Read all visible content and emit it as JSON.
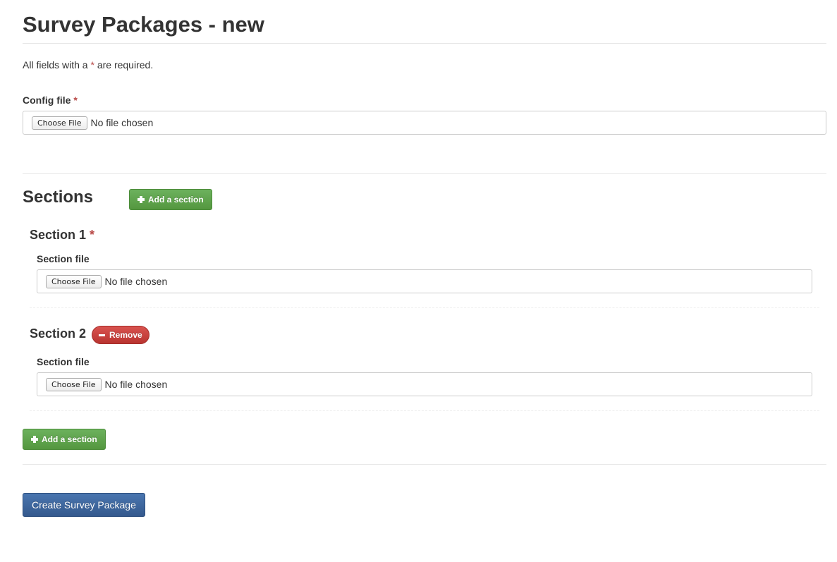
{
  "page": {
    "title": "Survey Packages - new",
    "required_note_prefix": "All fields with a ",
    "required_marker": "*",
    "required_note_suffix": " are required."
  },
  "config": {
    "label": "Config file",
    "choose_label": "Choose File",
    "status": "No file chosen"
  },
  "sections": {
    "heading": "Sections",
    "add_label": "Add a section",
    "items": [
      {
        "title": "Section 1",
        "file_label": "Section file",
        "choose_label": "Choose File",
        "status": "No file chosen"
      },
      {
        "title": "Section 2",
        "remove_label": "Remove",
        "file_label": "Section file",
        "choose_label": "Choose File",
        "status": "No file chosen"
      }
    ],
    "add_bottom_label": "Add a section"
  },
  "actions": {
    "submit_label": "Create Survey Package"
  },
  "colors": {
    "required": "#b94a48",
    "success": "#5cb85c",
    "danger": "#d9534f",
    "primary": "#3d669e"
  },
  "icons": [
    "plus-icon",
    "minus-icon"
  ]
}
